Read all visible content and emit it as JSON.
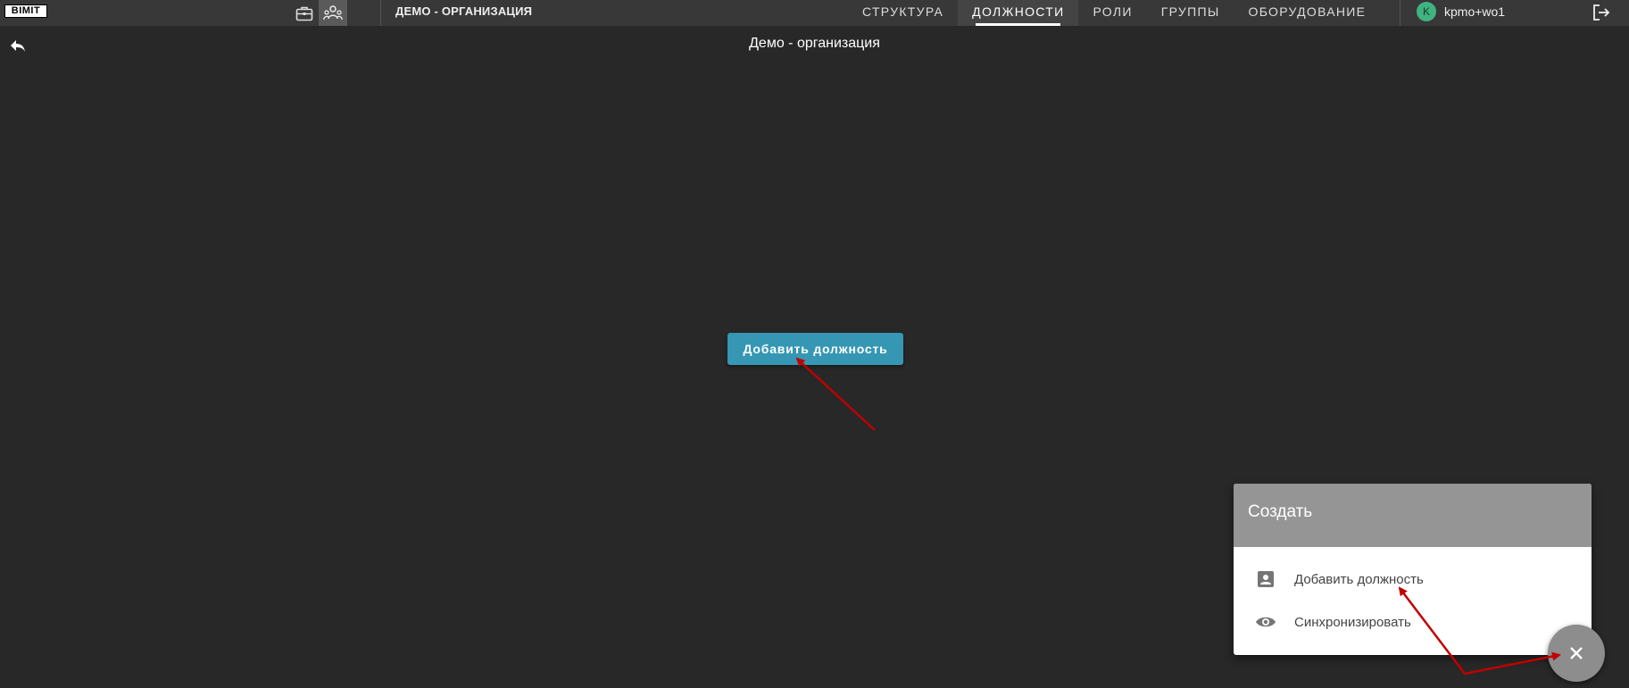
{
  "header": {
    "logo_text": "BIMIT",
    "org_title": "ДЕМО - ОРГАНИЗАЦИЯ",
    "tabs": [
      {
        "label": "СТРУКТУРА"
      },
      {
        "label": "ДОЛЖНОСТИ",
        "active": true
      },
      {
        "label": "РОЛИ"
      },
      {
        "label": "ГРУППЫ"
      },
      {
        "label": "ОБОРУДОВАНИЕ"
      }
    ],
    "user": {
      "avatar_letter": "K",
      "name": "kpmo+wo1"
    },
    "icons": [
      "briefcase-icon",
      "people-icon",
      "logout-icon"
    ]
  },
  "page": {
    "title": "Демо - организация",
    "back_icon": "reply-arrow-icon",
    "add_button_label": "Добавить должность"
  },
  "popup": {
    "title": "Создать",
    "items": [
      {
        "label": "Добавить должность",
        "icon": "account-box-icon"
      },
      {
        "label": "Синхронизировать",
        "icon": "eye-icon"
      }
    ]
  },
  "fab": {
    "icon": "close-icon"
  },
  "colors": {
    "background": "#282828",
    "topbar": "#383838",
    "accent_button": "#3597b4",
    "popup_header": "#959595",
    "avatar": "#3fb381",
    "annotation_arrow": "#c00000"
  }
}
